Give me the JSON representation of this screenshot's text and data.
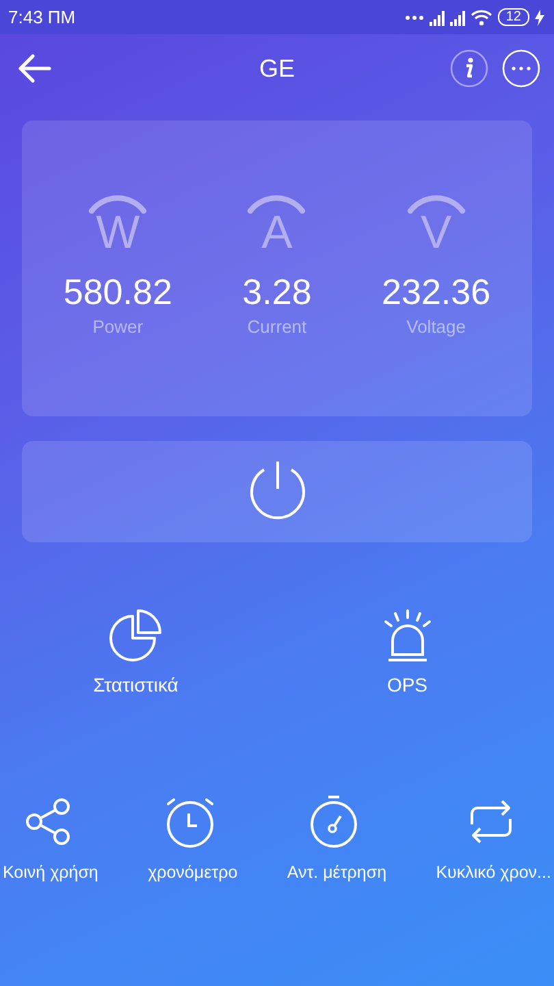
{
  "status_bar": {
    "time": "7:43 ПМ",
    "battery": "12"
  },
  "header": {
    "title": "GE"
  },
  "meters": [
    {
      "symbol": "W",
      "value": "580.82",
      "label": "Power"
    },
    {
      "symbol": "A",
      "value": "3.28",
      "label": "Current"
    },
    {
      "symbol": "V",
      "value": "232.36",
      "label": "Voltage"
    }
  ],
  "features": [
    {
      "kind": "chart",
      "label": "Στατιστικά"
    },
    {
      "kind": "siren",
      "label": "OPS"
    }
  ],
  "tools": [
    {
      "kind": "share",
      "label": "Κοινή χρήση"
    },
    {
      "kind": "alarm",
      "label": "χρονόμετρο"
    },
    {
      "kind": "stopwatch",
      "label": "Αντ. μέτρηση"
    },
    {
      "kind": "repeat",
      "label": "Κυκλικό χρον..."
    }
  ]
}
